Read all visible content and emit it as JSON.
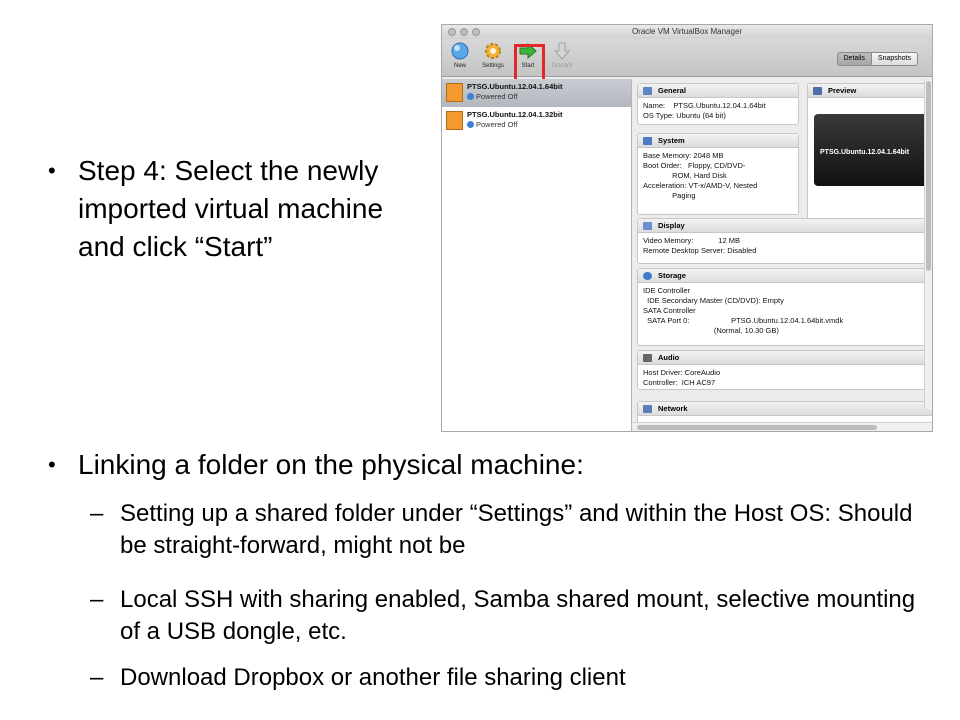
{
  "slide": {
    "step_text": "Step 4: Select the newly imported virtual machine and click “Start”",
    "linking_heading": "Linking a folder on the physical machine:",
    "sub_items": [
      "Setting up a shared folder under “Settings” and within the Host OS: Should be straight-forward, might not be",
      "Local SSH with sharing enabled, Samba shared mount, selective mounting of a USB dongle, etc.",
      "Download Dropbox or another file sharing client"
    ],
    "bullet_glyph": "•",
    "dash_glyph": "–"
  },
  "vbox": {
    "window_title": "Oracle VM VirtualBox Manager",
    "toolbar": {
      "new_label": "New",
      "settings_label": "Settings",
      "start_label": "Start",
      "discard_label": "Discard"
    },
    "view_toggle": {
      "details_label": "Details",
      "snapshots_label": "Snapshots"
    },
    "vms": [
      {
        "name": "PTSG.Ubuntu.12.04.1.64bit",
        "state": "Powered Off",
        "selected": true
      },
      {
        "name": "PTSG.Ubuntu.12.04.1.32bit",
        "state": "Powered Off",
        "selected": false
      }
    ],
    "general": {
      "title": "General",
      "body": "Name:    PTSG.Ubuntu.12.04.1.64bit\nOS Type: Ubuntu (64 bit)"
    },
    "preview": {
      "title": "Preview",
      "screen_text": "PTSG.Ubuntu.12.04.1.64bit"
    },
    "system": {
      "title": "System",
      "body": "Base Memory: 2048 MB\nBoot Order:   Floppy, CD/DVD-\n              ROM, Hard Disk\nAcceleration: VT-x/AMD-V, Nested\n              Paging"
    },
    "display": {
      "title": "Display",
      "body": "Video Memory:            12 MB\nRemote Desktop Server: Disabled"
    },
    "storage": {
      "title": "Storage",
      "body": "IDE Controller\n  IDE Secondary Master (CD/DVD): Empty\nSATA Controller\n  SATA Port 0:                    PTSG.Ubuntu.12.04.1.64bit.vmdk\n                                  (Normal, 10.30 GB)"
    },
    "audio": {
      "title": "Audio",
      "body": "Host Driver: CoreAudio\nController:  ICH AC97"
    },
    "network": {
      "title": "Network"
    },
    "colors": {
      "highlight_box": "#e3262a",
      "start_arrow": "#3cb33c",
      "os_icon": "#f29a2e",
      "power_icon": "#3b7fd6"
    }
  }
}
